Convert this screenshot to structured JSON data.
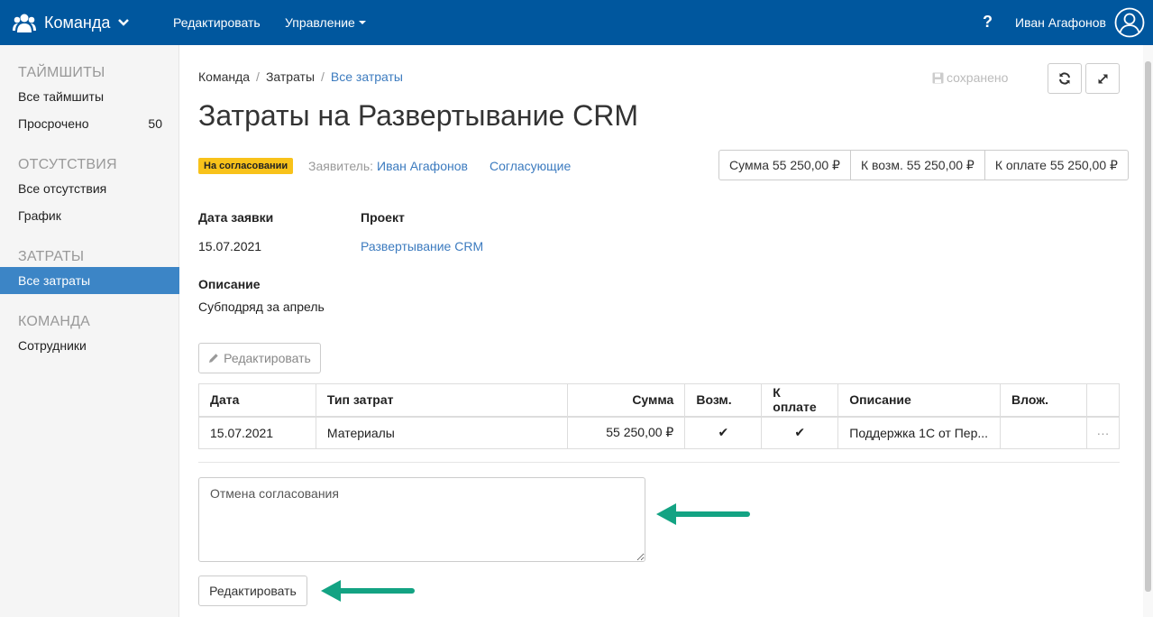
{
  "navbar": {
    "brand": "Команда",
    "links": [
      "Редактировать",
      "Управление"
    ],
    "help": "?",
    "user": "Иван Агафонов"
  },
  "sidebar": {
    "sections": [
      {
        "title": "ТАЙМШИТЫ",
        "items": [
          {
            "label": "Все таймшиты"
          },
          {
            "label": "Просрочено",
            "count": "50"
          }
        ]
      },
      {
        "title": "ОТСУТСТВИЯ",
        "items": [
          {
            "label": "Все отсутствия"
          },
          {
            "label": "График"
          }
        ]
      },
      {
        "title": "ЗАТРАТЫ",
        "items": [
          {
            "label": "Все затраты",
            "active": true
          }
        ]
      },
      {
        "title": "КОМАНДА",
        "items": [
          {
            "label": "Сотрудники"
          }
        ]
      }
    ]
  },
  "breadcrumb": [
    "Команда",
    "Затраты",
    "Все затраты"
  ],
  "saved_status": "сохранено",
  "title": "Затраты на Развертывание CRM",
  "status_badge": "На согласовании",
  "applicant": {
    "label": "Заявитель:",
    "name": "Иван Агафонов"
  },
  "approvers_link": "Согласующие",
  "totals": {
    "sum": "Сумма 55 250,00 ₽",
    "reimb": "К возм. 55 250,00 ₽",
    "to_pay": "К оплате 55 250,00 ₽"
  },
  "fields": {
    "date_label": "Дата заявки",
    "date_value": "15.07.2021",
    "project_label": "Проект",
    "project_value": "Развертывание CRM",
    "description_label": "Описание",
    "description_value": "Субподряд за апрель"
  },
  "edit_button_top": "Редактировать",
  "table": {
    "headers": [
      "Дата",
      "Тип затрат",
      "Сумма",
      "Возм.",
      "К оплате",
      "Описание",
      "Влож.",
      ""
    ],
    "rows": [
      {
        "date": "15.07.2021",
        "type": "Материалы",
        "amount": "55 250,00 ₽",
        "reimb": "✔",
        "to_pay": "✔",
        "description": "Поддержка 1С от Пер...",
        "attachment": "",
        "menu": "···"
      }
    ]
  },
  "comment": {
    "value": "Отмена согласования"
  },
  "edit_button_bottom": "Редактировать",
  "colors": {
    "navbar": "#00579e",
    "active": "#3c85c6",
    "link": "#3c7bbf",
    "badge": "#f8c21a",
    "arrow": "#13a383"
  }
}
